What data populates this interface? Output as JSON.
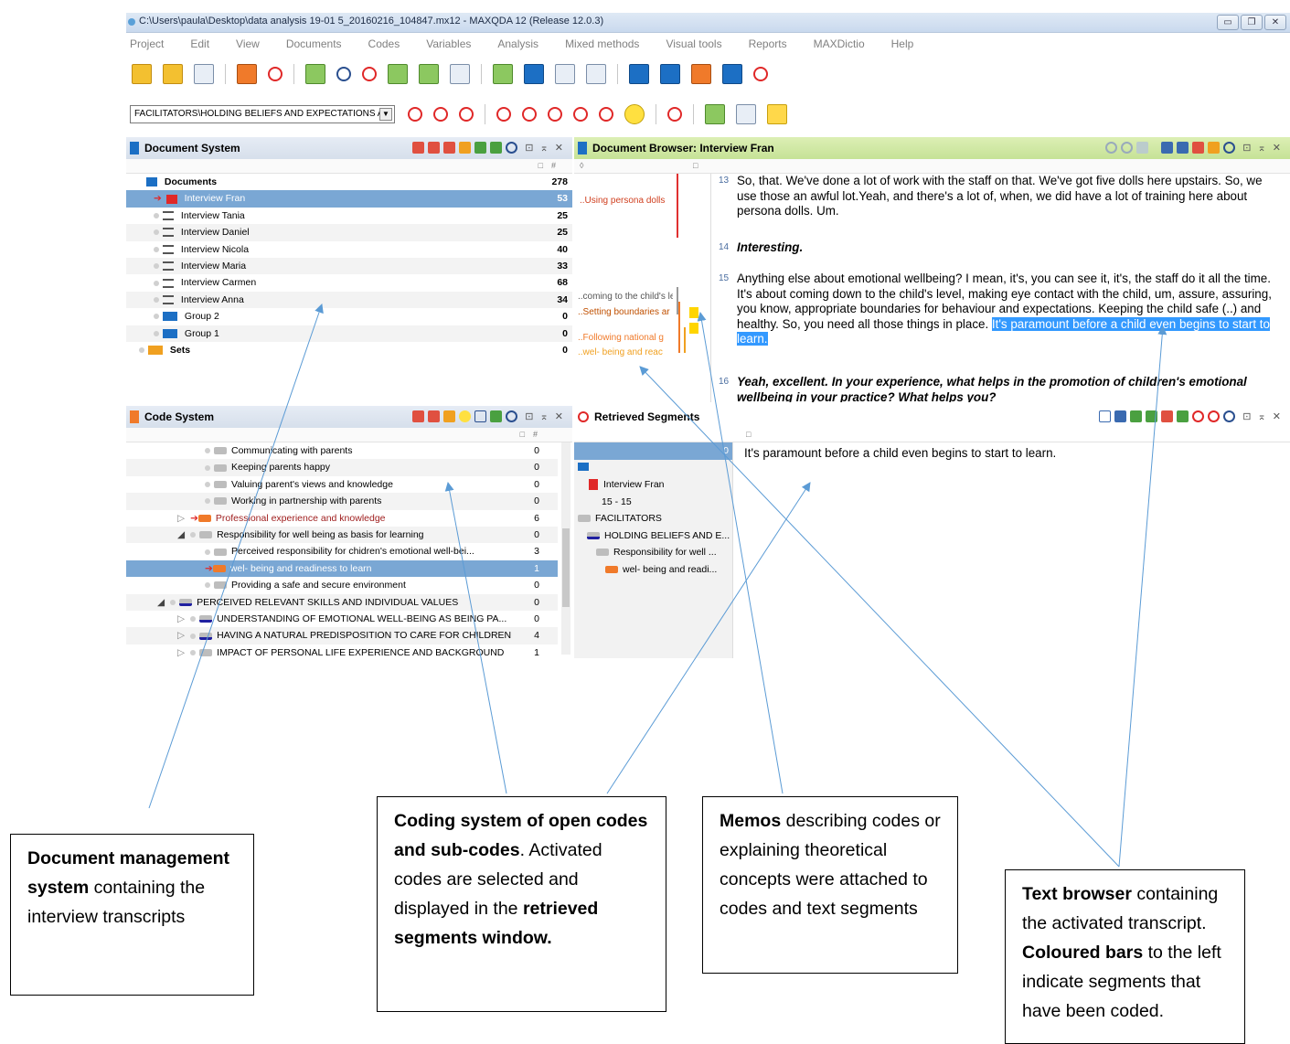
{
  "window": {
    "title": "C:\\Users\\paula\\Desktop\\data analysis 19-01 5_20160216_104847.mx12 - MAXQDA 12  (Release 12.0.3)"
  },
  "menu": [
    "Project",
    "Edit",
    "View",
    "Documents",
    "Codes",
    "Variables",
    "Analysis",
    "Mixed methods",
    "Visual tools",
    "Reports",
    "MAXDictio",
    "Help"
  ],
  "toolbar": {
    "code_select": "FACILITATORS\\HOLDING BELIEFS AND EXPECTATIONS A"
  },
  "document_system": {
    "title": "Document System",
    "col_hash": "#",
    "rows": [
      {
        "label": "Documents",
        "count": "278"
      },
      {
        "label": "Interview Fran",
        "count": "53"
      },
      {
        "label": "Interview Tania",
        "count": "25"
      },
      {
        "label": "Interview Daniel",
        "count": "25"
      },
      {
        "label": "Interview Nicola",
        "count": "40"
      },
      {
        "label": "Interview Maria",
        "count": "33"
      },
      {
        "label": "Interview Carmen",
        "count": "68"
      },
      {
        "label": "Interview Anna",
        "count": "34"
      },
      {
        "label": "Group 2",
        "count": "0"
      },
      {
        "label": "Group 1",
        "count": "0"
      },
      {
        "label": "Sets",
        "count": "0"
      }
    ]
  },
  "code_system": {
    "title": "Code System",
    "col_hash": "#",
    "rows": [
      {
        "label": "Communicating with parents",
        "count": "0"
      },
      {
        "label": "Keeping parents happy",
        "count": "0"
      },
      {
        "label": "Valuing parent's views and knowledge",
        "count": "0"
      },
      {
        "label": "Working in partnership with parents",
        "count": "0"
      },
      {
        "label": "Professional experience and knowledge",
        "count": "6"
      },
      {
        "label": "Responsibility for well being as basis for learning",
        "count": "0"
      },
      {
        "label": "Perceived responsibility for chidren's emotional well-bei...",
        "count": "3"
      },
      {
        "label": "wel- being and readiness to learn",
        "count": "1"
      },
      {
        "label": "Providing a safe and secure environment",
        "count": "0"
      },
      {
        "label": "PERCEIVED RELEVANT SKILLS AND INDIVIDUAL VALUES",
        "count": "0"
      },
      {
        "label": "UNDERSTANDING OF EMOTIONAL WELL-BEING AS BEING PA...",
        "count": "0"
      },
      {
        "label": "HAVING A NATURAL PREDISPOSITION TO CARE FOR CHILDREN",
        "count": "4"
      },
      {
        "label": "IMPACT OF PERSONAL LIFE EXPERIENCE AND BACKGROUND",
        "count": "1"
      }
    ]
  },
  "document_browser": {
    "title": "Document Browser: Interview Fran",
    "memos": [
      "..Using persona dolls",
      "..coming to the child's le",
      "..Setting boundaries ar",
      "..Following national g",
      "..wel- being and reac"
    ],
    "paragraphs": [
      {
        "num": "13",
        "text": "So, that.  We've done a lot of work with the staff on that.  We've got five dolls here upstairs.  So, we use those an awful lot.Yeah, and there's a lot of, when, we did have a lot of training here about persona dolls.  Um."
      },
      {
        "num": "14",
        "text": "Interesting."
      },
      {
        "num": "15",
        "text": "Anything else about emotional wellbeing?  I mean, it's, you can see it, it's, the staff do it all the time.  It's about coming down to the child's level, making eye contact with the child, um, assure, assuring, you know, appropriate boundaries for behaviour and expectations.  Keeping the child safe (..) and healthy.  So, you need all those things in place. ",
        "highlight": "It's paramount before a child even begins to start to learn."
      },
      {
        "num": "16",
        "text": "Yeah, excellent.  In your experience, what helps in the promotion of children's emotional wellbeing in your practice?  What helps you?"
      }
    ]
  },
  "retrieved_segments": {
    "title": "Retrieved Segments",
    "count": "0",
    "tree": [
      "Interview Fran",
      "15 - 15",
      "FACILITATORS",
      "HOLDING BELIEFS AND E...",
      "Responsibility for well ...",
      "wel- being and readi..."
    ],
    "segment_text": "It's paramount before a child even begins to start to learn."
  },
  "callouts": {
    "doc_mgmt": {
      "bold": "Document management system",
      "rest": " containing the interview transcripts"
    },
    "coding": {
      "bold1": "Coding system of open codes and sub-codes",
      "mid": ". Activated codes are selected and displayed in the ",
      "bold2": "retrieved segments window."
    },
    "memos": {
      "bold": "Memos",
      "rest": " describing codes or explaining theoretical concepts were attached to codes and text segments"
    },
    "text_browser": {
      "bold1": "Text browser",
      "mid": " containing the activated transcript. ",
      "bold2": "Coloured bars",
      "rest": " to the left indicate segments that have been coded."
    }
  },
  "colors": {
    "selection": "#7aa7d4",
    "highlight": "#3399ff",
    "browser_header": "#c6e296",
    "code_red": "#e02828",
    "code_orange": "#f07a2a"
  }
}
